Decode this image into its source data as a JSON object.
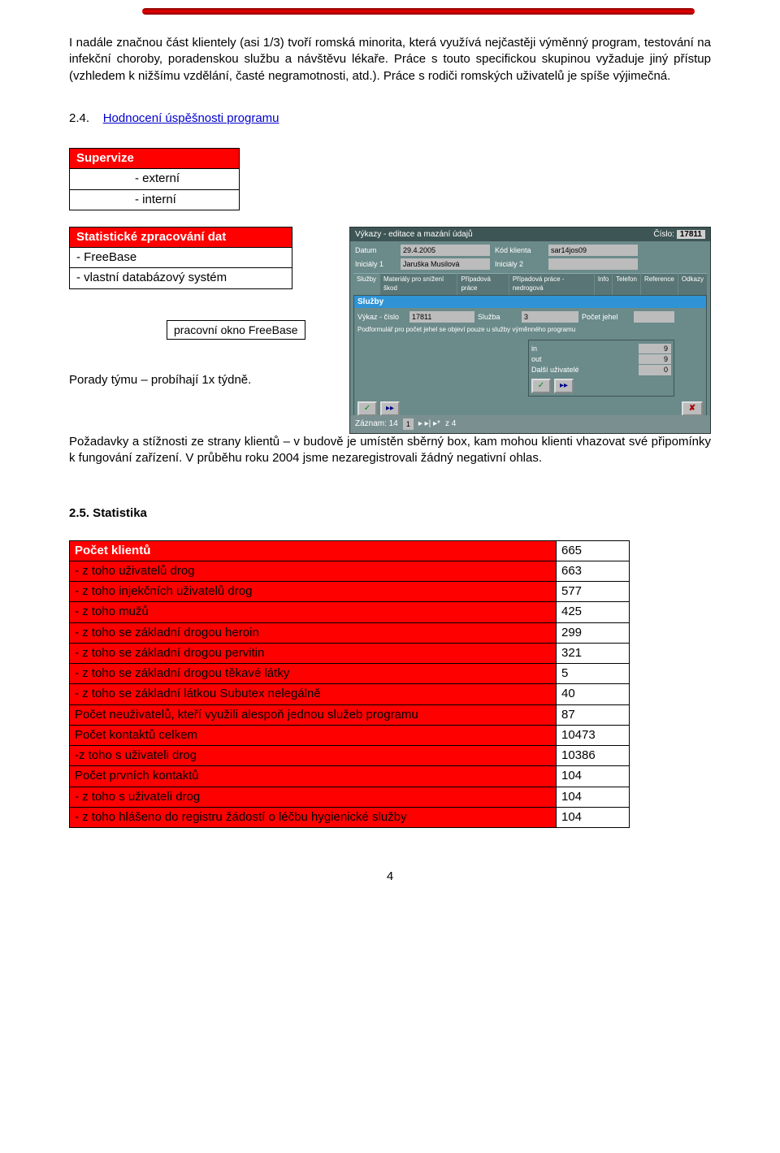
{
  "paragraphs": {
    "p1": "I nadále značnou část klientely (asi 1/3) tvoří romská minorita, která využívá nejčastěji výměnný program, testování na infekční choroby, poradenskou službu a návštěvu lékaře. Práce s touto specifickou skupinou vyžaduje jiný přístup (vzhledem k nižšímu vzdělání, časté negramotnosti, atd.). Práce s rodiči romských uživatelů je spíše výjimečná.",
    "section24_num": "2.4.",
    "section24_link": "Hodnocení úspěšnosti programu",
    "p2": "Porady týmu – probíhají 1x týdně.",
    "p3": "Požadavky a stížnosti ze strany klientů – v budově je umístěn sběrný box, kam mohou klienti vhazovat své připomínky k fungování zařízení. V průběhu roku 2004 jsme nezaregistrovali žádný negativní ohlas.",
    "section25": "2.5. Statistika"
  },
  "tables": {
    "supervize": {
      "header": "Supervize",
      "rows": [
        "- externí",
        "- interní"
      ]
    },
    "stat_dat": {
      "header": "Statistické zpracování dat",
      "rows": [
        "- FreeBase",
        "- vlastní databázový systém"
      ]
    },
    "caption": "pracovní okno FreeBase"
  },
  "stats": {
    "header": "Počet klientů",
    "header_value": "665",
    "rows": [
      {
        "label": "- z toho uživatelů drog",
        "value": "663",
        "red": true
      },
      {
        "label": "- z toho injekčních uživatelů drog",
        "value": "577",
        "red": true
      },
      {
        "label": "- z toho mužů",
        "value": "425",
        "red": true
      },
      {
        "label": "- z toho se základní drogou heroin",
        "value": "299",
        "red": true
      },
      {
        "label": "- z toho se základní drogou pervitin",
        "value": "321",
        "red": true
      },
      {
        "label": "- z toho se základní drogou těkavé látky",
        "value": "5",
        "red": true
      },
      {
        "label": "- z toho se základní látkou Subutex nelegálně",
        "value": "40",
        "red": true
      },
      {
        "label": "Počet neuživatelů, kteří využili alespoň jednou služeb programu",
        "value": "87",
        "red": true
      },
      {
        "label": "Počet kontaktů celkem",
        "value": "10473",
        "red": true
      },
      {
        "label": "-z toho s uživateli drog",
        "value": "10386",
        "red": true
      },
      {
        "label": "Počet prvních kontaktů",
        "value": "104",
        "red": true
      },
      {
        "label": "- z toho s uživateli drog",
        "value": "104",
        "red": true
      },
      {
        "label": "- z toho hlášeno do registru žádostí o léčbu hygienické služby",
        "value": "104",
        "red": true
      }
    ]
  },
  "page_number": "4",
  "screenshot": {
    "title": "Výkazy - editace a mazání údajů",
    "cislo_label": "Číslo:",
    "cislo_value": "17811",
    "datum_label": "Datum",
    "datum_value": "29.4.2005",
    "kod_label": "Kód klienta",
    "kod_value": "sar14jos09",
    "inic1_label": "Iniciály 1",
    "inic1_value": "Jaruška Musilová",
    "inic2_label": "Iniciály 2",
    "tabs": [
      "Služby",
      "Materiály pro snížení škod",
      "Případová práce",
      "Případová práce - nedrogová",
      "Info",
      "Telefon",
      "Reference",
      "Odkazy"
    ],
    "sub_header": "Služby",
    "vykaz_label": "Výkaz - číslo",
    "vykaz_value": "17811",
    "sluzba_label": "Služba",
    "sluzba_value": "3",
    "pocet_label": "Počet jehel",
    "note": "Podformulář pro počet jehel se objeví pouze u služby výměnného programu",
    "in_label": "in",
    "in_value": "9",
    "out_label": "out",
    "out_value": "9",
    "dalsi_label": "Další uživatelé",
    "dalsi_value": "0",
    "check_icon": "✓",
    "arrow_icon": "▸▸",
    "close_icon": "✘",
    "footer_zaznam": "Záznam: 14",
    "footer_nav1": "1",
    "footer_nav2": "▸ ▸| ▸*",
    "footer_z": "z 4"
  }
}
